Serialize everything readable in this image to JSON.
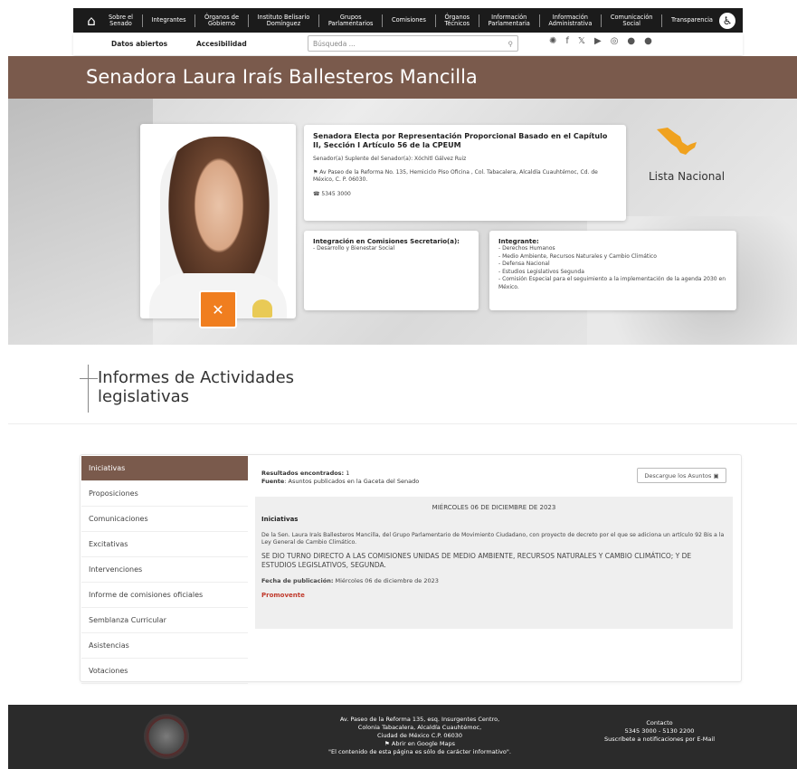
{
  "nav": {
    "items": [
      "Sobre el\nSenado",
      "Integrantes",
      "Órganos de\nGobierno",
      "Instituto Belisario\nDomínguez",
      "Grupos\nParlamentarios",
      "Comisiones",
      "Órganos\nTécnicos",
      "Información\nParlamentaria",
      "Información\nAdministrativa",
      "Comunicación\nSocial",
      "Transparencia"
    ],
    "home_icon": "home-icon",
    "access_icon": "accessibility-icon"
  },
  "subnav": {
    "open_data": "Datos abiertos",
    "accessibility": "Accesibilidad",
    "search_placeholder": "Búsqueda ...",
    "search_icon": "search-icon"
  },
  "senator": {
    "name": "Senadora Laura Iraís Ballesteros Mancilla",
    "election": "Senadora Electa por Representación Proporcional Basado en el Capítulo II, Sección I Artículo 56 de la CPEUM",
    "substitute": "Senador(a) Suplente del Senador(a): Xóchitl Gálvez Ruiz",
    "address": "Av Paseo de la Reforma No. 135, Hemiciclo Piso Oficina , Col. Tabacalera, Alcaldía Cuauhtémoc, Cd. de México, C. P. 06030.",
    "phone": "5345 3000",
    "list": "Lista Nacional"
  },
  "committees": {
    "secretary_title": "Integración en Comisiones Secretario(a):",
    "secretary_items": [
      "- Desarrollo y Bienestar Social"
    ],
    "member_title": "Integrante:",
    "member_items": [
      "- Derechos Humanos",
      "- Medio Ambiente, Recursos Naturales y Cambio Climático",
      "- Defensa Nacional",
      "- Estudios Legislativos Segunda",
      "- Comisión Especial para el seguimiento a la implementación de la agenda 2030 en México."
    ]
  },
  "section": {
    "title": "Informes de Actividades legislativas"
  },
  "tabs": [
    "Iniciativas",
    "Proposiciones",
    "Comunicaciones",
    "Excitativas",
    "Intervenciones",
    "Informe de comisiones oficiales",
    "Semblanza Curricular",
    "Asistencias",
    "Votaciones"
  ],
  "results": {
    "found_label": "Resultados encontrados:",
    "found_value": "1",
    "source_label": "Fuente",
    "source_value": ": Asuntos publicados en la Gaceta del Senado",
    "download": "Descargue los Asuntos"
  },
  "entry": {
    "date": "MIÉRCOLES 06 DE DICIEMBRE DE 2023",
    "title": "Iniciativas",
    "description": "De la Sen. Laura Iraís Ballesteros Mancilla, del Grupo Parlamentario de Movimiento Ciudadano, con proyecto de decreto por el que se adiciona un artículo 92 Bis a la Ley General de Cambio Climático.",
    "status": "SE DIO TURNO DIRECTO A LAS COMISIONES UNIDAS DE MEDIO AMBIENTE, RECURSOS NATURALES Y CAMBIO CLIMÁTICO; Y DE ESTUDIOS LEGISLATIVOS, SEGUNDA.",
    "pub_label": "Fecha de publicación:",
    "pub_value": " Miércoles 06 de diciembre de 2023",
    "promovente": "Promovente"
  },
  "footer": {
    "address_lines": [
      "Av. Paseo de la Reforma 135, esq. Insurgentes Centro,",
      "Colonia Tabacalera, Alcaldía Cuauhtémoc,",
      "Ciudad de México C.P. 06030"
    ],
    "maps": "Abrir en Google Maps",
    "disclaimer": "\"El contenido de esta página es sólo de carácter informativo\".",
    "contact_title": "Contacto",
    "contact_phone": "5345 3000 - 5130 2200",
    "subscribe": "Suscríbete a notificaciones por E-Mail"
  },
  "colors": {
    "brand": "#7a5a4c",
    "party": "#f07e1f",
    "promovente": "#c0392b"
  }
}
